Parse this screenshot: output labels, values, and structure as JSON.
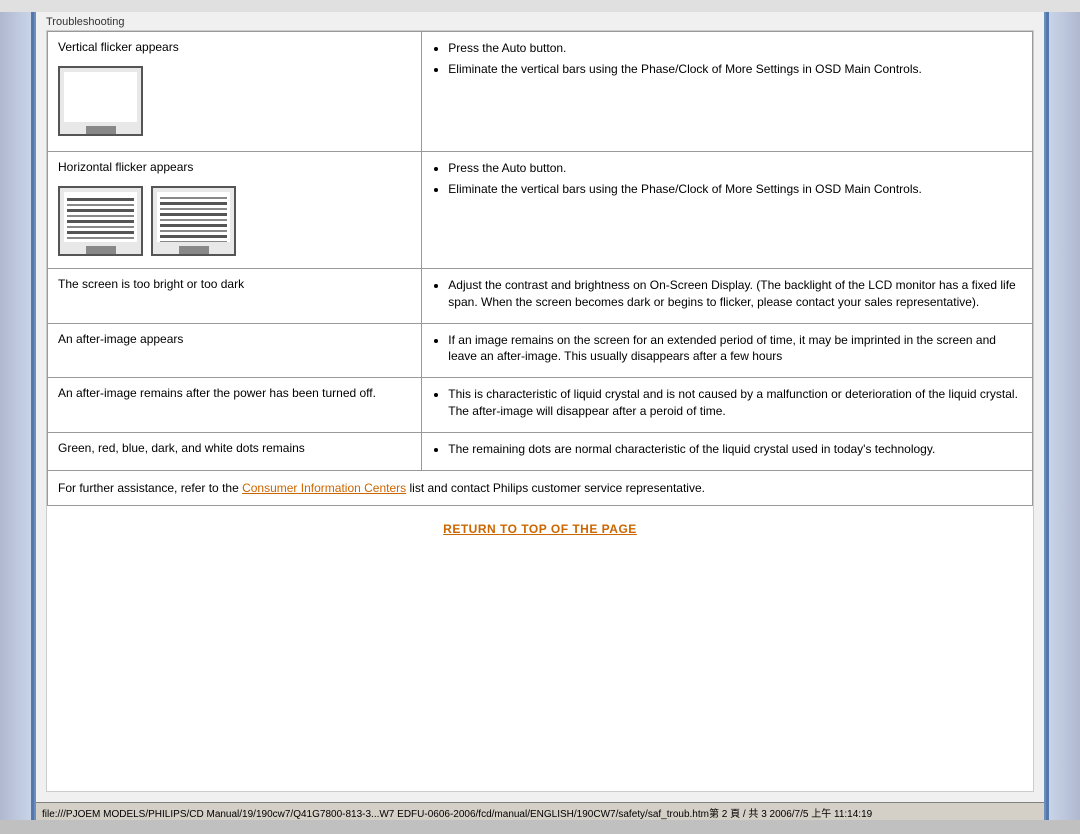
{
  "header": {
    "label": "Troubleshooting"
  },
  "table": {
    "rows": [
      {
        "id": "vertical-flicker",
        "problem": "Vertical flicker appears",
        "has_image": true,
        "image_type": "vertical",
        "solutions": [
          "Press the Auto button.",
          "Eliminate the vertical bars using the Phase/Clock of More Settings in OSD Main Controls."
        ]
      },
      {
        "id": "horizontal-flicker",
        "problem": "Horizontal flicker appears",
        "has_image": true,
        "image_type": "horizontal",
        "solutions": [
          "Press the Auto button.",
          "Eliminate the vertical bars using the Phase/Clock of More Settings in OSD Main Controls."
        ]
      },
      {
        "id": "brightness",
        "problem": "The screen is too bright or too dark",
        "has_image": false,
        "solutions": [],
        "description": "Adjust the contrast and brightness on On-Screen Display. (The backlight of the LCD monitor has a fixed life span. When the screen becomes dark or begins to flicker, please contact your sales representative)."
      },
      {
        "id": "after-image",
        "problem": "An after-image appears",
        "has_image": false,
        "solutions": [],
        "description": "If an image remains on the screen for an extended period of time, it may be imprinted in the screen and leave an after-image. This usually disappears after a few hours"
      },
      {
        "id": "after-image-power",
        "problem": "An after-image remains after the power has been turned off.",
        "has_image": false,
        "solutions": [],
        "description": "This is characteristic of liquid crystal and is not caused by a malfunction or deterioration of the liquid crystal. The after-image will disappear after a peroid of time."
      },
      {
        "id": "dots",
        "problem": "Green, red, blue, dark, and white dots remains",
        "has_image": false,
        "solutions": [],
        "description": "The remaining dots are normal characteristic of the liquid crystal used in today's technology."
      }
    ],
    "footer": {
      "text_before_link": "For further assistance, refer to the ",
      "link_text": "Consumer Information Centers",
      "text_after_link": " list and contact Philips customer service representative."
    }
  },
  "return_link": "RETURN TO TOP OF THE PAGE",
  "status_bar": {
    "text": "file:///PJOEM MODELS/PHILIPS/CD Manual/19/190cw7/Q41G7800-813-3...W7 EDFU-0606-2006/fcd/manual/ENGLISH/190CW7/safety/saf_troub.htm第 2 頁 / 共 3 2006/7/5 上午 11:14:19"
  }
}
